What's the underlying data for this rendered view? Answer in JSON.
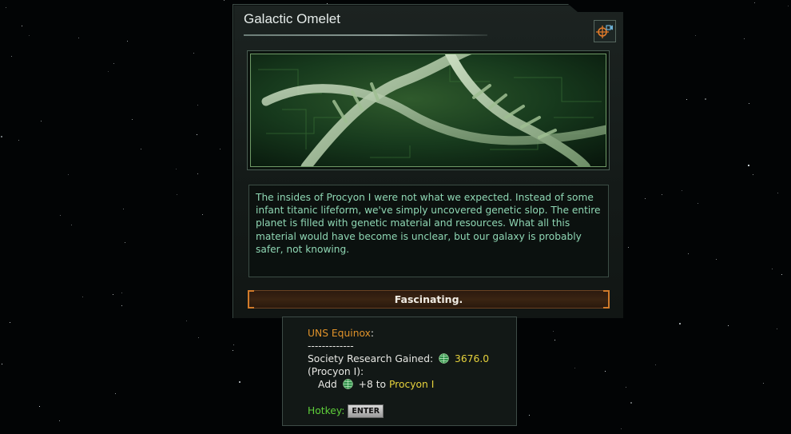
{
  "event": {
    "title": "Galactic Omelet",
    "description": "The insides of Procyon I were not what we expected. Instead of some infant titanic lifeform, we've simply uncovered genetic slop. The entire planet is filled with genetic material and resources. What all this material would have become is unclear, but our galaxy is probably safer, not knowing.",
    "option_label": "Fascinating.",
    "location_icon": "camera-target-icon",
    "picture": "dna-helix-illustration"
  },
  "tooltip": {
    "ship": "UNS Equinox",
    "ship_colon": ":",
    "separator": "-------------",
    "research_label": "Society Research Gained:",
    "research_value": "3676.0",
    "research_icon": "society-research-icon",
    "planet_ref": "(Procyon I):",
    "add_label": "Add",
    "add_value": "+8 to",
    "add_target": "Procyon I",
    "hotkey_label": "Hotkey:",
    "hotkey_key": "ENTER"
  },
  "colors": {
    "accent_orange": "#e0922a",
    "value_yellow": "#e6d23c",
    "text_green": "#8fd7b4",
    "hotkey_green": "#5ecf3a"
  }
}
